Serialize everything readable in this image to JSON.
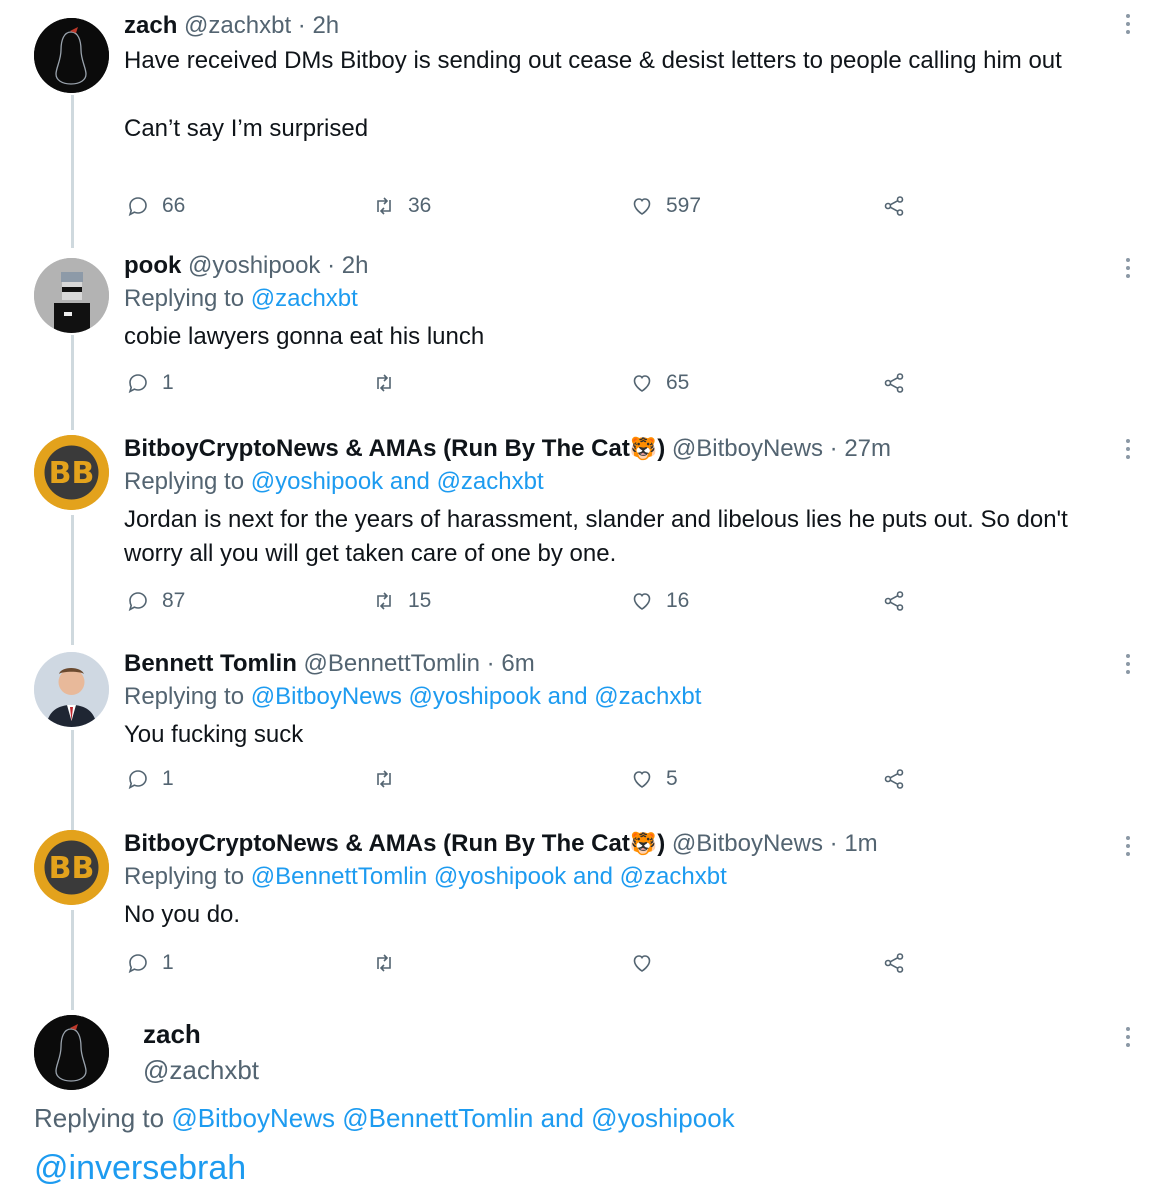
{
  "tweets": [
    {
      "name": "zach",
      "handle": "@zachxbt",
      "sep": "·",
      "time": "2h",
      "text": "Have received DMs Bitboy is sending out cease & desist letters to people calling him out\n\nCan’t say I’m surprised",
      "replies": "66",
      "retweets": "36",
      "likes": "597"
    },
    {
      "name": "pook",
      "handle": "@yoshipook",
      "sep": "·",
      "time": "2h",
      "replying_prefix": "Replying to",
      "replying_to": "@zachxbt",
      "text": "cobie lawyers gonna eat his lunch",
      "replies": "1",
      "retweets": "",
      "likes": "65"
    },
    {
      "name": "BitboyCryptoNews & AMAs (Run By The Cat",
      "name_emoji": "🐯",
      "name_close": ")",
      "handle": "@BitboyNews",
      "sep": "·",
      "time": "27m",
      "replying_prefix": "Replying to",
      "replying_to": "@yoshipook and @zachxbt",
      "text": "Jordan is next for the years of harassment, slander and libelous lies he puts out. So don't worry all you will get taken care of one by one.",
      "replies": "87",
      "retweets": "15",
      "likes": "16"
    },
    {
      "name": "Bennett Tomlin",
      "handle": "@BennettTomlin",
      "sep": "·",
      "time": "6m",
      "replying_prefix": "Replying to",
      "replying_to": "@BitboyNews @yoshipook and @zachxbt",
      "text": "You fucking suck",
      "replies": "1",
      "retweets": "",
      "likes": "5"
    },
    {
      "name": "BitboyCryptoNews & AMAs (Run By The Cat",
      "name_emoji": "🐯",
      "name_close": ")",
      "handle": "@BitboyNews",
      "sep": "·",
      "time": "1m",
      "replying_prefix": "Replying to",
      "replying_to": "@BennettTomlin @yoshipook and @zachxbt",
      "text": "No you do.",
      "replies": "1",
      "retweets": "",
      "likes": ""
    }
  ],
  "final": {
    "name": "zach",
    "handle": "@zachxbt",
    "replying_prefix": "Replying to",
    "replying_to": "@BitboyNews @BennettTomlin and @yoshipook",
    "text": "@inversebrah"
  },
  "icons": {
    "reply": "reply-icon",
    "retweet": "retweet-icon",
    "like": "heart-icon",
    "share": "share-icon",
    "more": "more-icon"
  },
  "colors": {
    "link": "#1d9bf0",
    "muted": "#536471",
    "text": "#0f1419",
    "thread_line": "#cfd9de",
    "bitboy_gold": "#e3a21c"
  }
}
